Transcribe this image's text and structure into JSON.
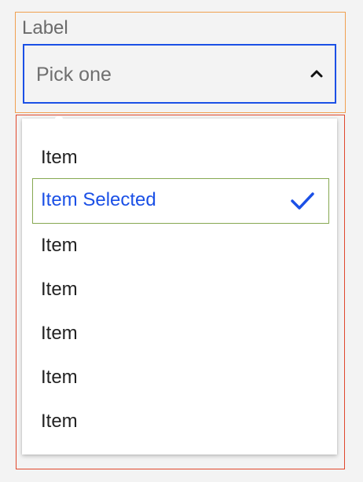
{
  "field": {
    "label": "Label",
    "placeholder": "Pick one",
    "expanded": true
  },
  "menu": {
    "items": [
      {
        "label": "Item",
        "selected": false
      },
      {
        "label": "Item Selected",
        "selected": true
      },
      {
        "label": "Item",
        "selected": false
      },
      {
        "label": "Item",
        "selected": false
      },
      {
        "label": "Item",
        "selected": false
      },
      {
        "label": "Item",
        "selected": false
      },
      {
        "label": "Item",
        "selected": false
      }
    ]
  },
  "icons": {
    "chevron": "chevron-up-icon",
    "check": "check-icon"
  },
  "colors": {
    "accent": "#1b50e6",
    "label_text": "#6b6b6b",
    "item_text": "#222222",
    "selection_outline": "#86a851",
    "field_outline": "#f0a050",
    "menu_outline": "#e0472c"
  }
}
